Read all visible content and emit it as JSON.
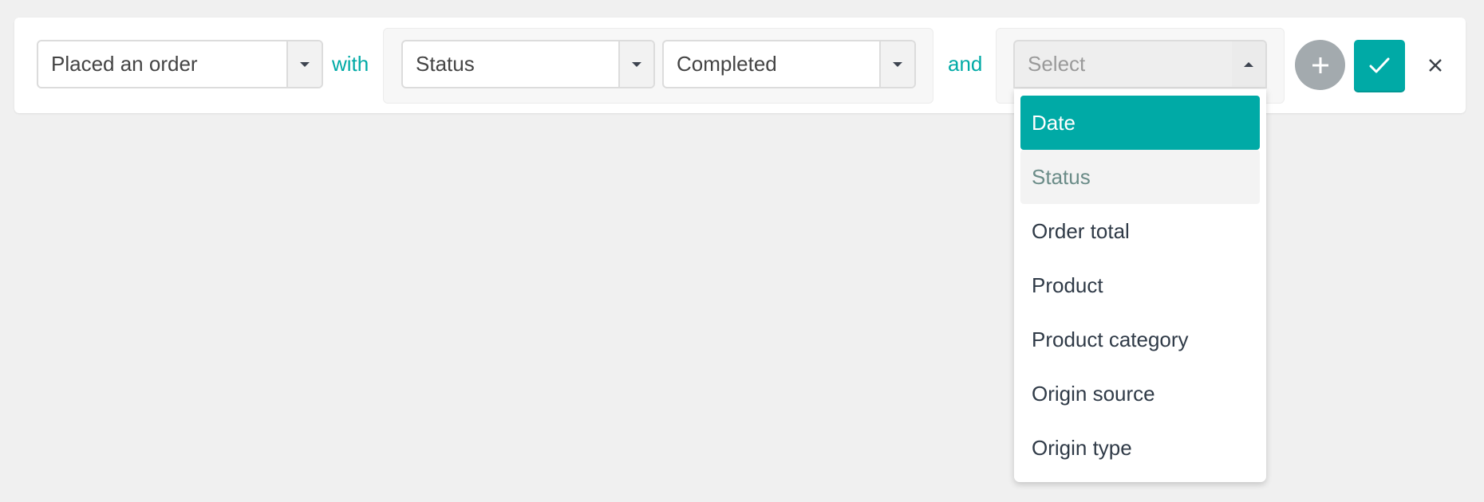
{
  "filter": {
    "event_select": {
      "value": "Placed an order",
      "icon": "caret-down-icon"
    },
    "with_label": "with",
    "property_select": {
      "value": "Status",
      "icon": "caret-down-icon"
    },
    "value_select": {
      "value": "Completed",
      "icon": "caret-down-icon"
    },
    "and_label": "and",
    "new_property_select": {
      "placeholder": "Select",
      "icon": "caret-up-icon",
      "open": true
    },
    "dropdown_options": [
      {
        "label": "Date",
        "state": "selected"
      },
      {
        "label": "Status",
        "state": "hover"
      },
      {
        "label": "Order total",
        "state": ""
      },
      {
        "label": "Product",
        "state": ""
      },
      {
        "label": "Product category",
        "state": ""
      },
      {
        "label": "Origin source",
        "state": ""
      },
      {
        "label": "Origin type",
        "state": ""
      }
    ],
    "actions": {
      "add_icon": "plus-icon",
      "confirm_icon": "check-icon",
      "close_icon": "close-icon"
    }
  },
  "colors": {
    "accent": "#00aaa6",
    "add_button": "#a3aaae",
    "background": "#f0f0f0",
    "hover_text": "#6b8c88"
  }
}
